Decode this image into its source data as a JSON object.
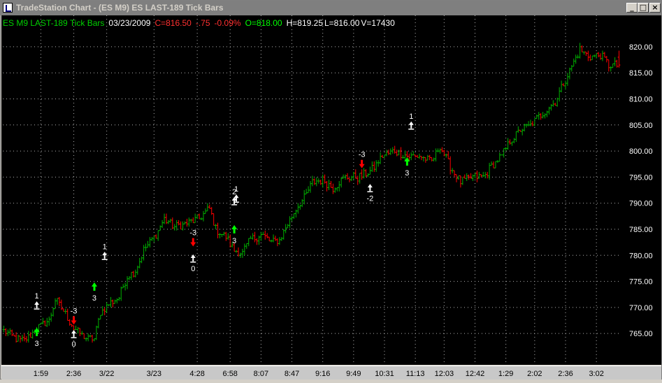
{
  "window": {
    "title": "TradeStation Chart - (ES M9) ES LAST-189 Tick Bars",
    "minimize": "_",
    "maximize": "□",
    "close": "×"
  },
  "info": {
    "symbol": "ES M9 LAST-189 Tick Bars",
    "date": "03/23/2009",
    "close": "C=816.50",
    "change": "-.75",
    "change_pct": "-0.09%",
    "open": "O=818.00",
    "high": "H=819.25",
    "low": "L=816.00",
    "volume": "V=17430"
  },
  "colors": {
    "background": "#000000",
    "up_bar": "#00b000",
    "down_bar": "#ff0000",
    "grid": "#b0b0b0",
    "info_symbol": "#00d000",
    "info_date": "#ffffff",
    "info_close": "#ff3030",
    "info_open": "#00ff00",
    "info_other": "#ffffff",
    "buy_arrow": "#00ff00",
    "sell_arrow": "#ff0000",
    "marker": "#ffffff"
  },
  "chart_data": {
    "type": "bar",
    "subtype": "ohlc-tick-bars",
    "grid": true,
    "y_axis_side": "right",
    "ylim": [
      761,
      822
    ],
    "y_ticks": [
      765,
      770,
      775,
      780,
      785,
      790,
      795,
      800,
      805,
      810,
      815,
      820
    ],
    "y_tick_labels": [
      "765.00",
      "770.00",
      "775.00",
      "780.00",
      "785.00",
      "790.00",
      "795.00",
      "800.00",
      "805.00",
      "810.00",
      "815.00",
      "820.00"
    ],
    "x_count": 300,
    "x_ticks": [
      {
        "label": "1:59",
        "i": 18
      },
      {
        "label": "2:36",
        "i": 34
      },
      {
        "label": "3/22",
        "i": 50
      },
      {
        "label": "3/23",
        "i": 73
      },
      {
        "label": "4:28",
        "i": 94
      },
      {
        "label": "6:58",
        "i": 110
      },
      {
        "label": "8:07",
        "i": 125
      },
      {
        "label": "8:47",
        "i": 140
      },
      {
        "label": "9:16",
        "i": 155
      },
      {
        "label": "9:49",
        "i": 170
      },
      {
        "label": "10:31",
        "i": 185
      },
      {
        "label": "11:13",
        "i": 200
      },
      {
        "label": "12:03",
        "i": 214
      },
      {
        "label": "12:42",
        "i": 229
      },
      {
        "label": "1:29",
        "i": 244
      },
      {
        "label": "2:02",
        "i": 258
      },
      {
        "label": "2:36",
        "i": 273
      },
      {
        "label": "3:02",
        "i": 288
      }
    ],
    "price_path": [
      [
        0,
        765.5
      ],
      [
        6,
        764
      ],
      [
        10,
        763.5
      ],
      [
        16,
        766
      ],
      [
        22,
        767.5
      ],
      [
        25,
        771.5
      ],
      [
        28,
        770
      ],
      [
        34,
        766
      ],
      [
        40,
        764
      ],
      [
        44,
        764
      ],
      [
        47,
        769
      ],
      [
        52,
        771
      ],
      [
        56,
        772
      ],
      [
        60,
        776
      ],
      [
        64,
        777
      ],
      [
        68,
        781
      ],
      [
        74,
        784
      ],
      [
        78,
        787
      ],
      [
        83,
        785.5
      ],
      [
        88,
        786
      ],
      [
        95,
        787
      ],
      [
        100,
        789
      ],
      [
        103,
        785
      ],
      [
        108,
        783.5
      ],
      [
        112,
        781
      ],
      [
        116,
        780.5
      ],
      [
        120,
        783
      ],
      [
        125,
        784
      ],
      [
        130,
        782.5
      ],
      [
        134,
        783
      ],
      [
        138,
        786
      ],
      [
        142,
        789
      ],
      [
        146,
        791
      ],
      [
        150,
        794
      ],
      [
        155,
        794.5
      ],
      [
        160,
        793
      ],
      [
        166,
        795
      ],
      [
        172,
        795
      ],
      [
        178,
        796
      ],
      [
        184,
        799
      ],
      [
        190,
        800
      ],
      [
        196,
        799
      ],
      [
        202,
        799
      ],
      [
        208,
        798
      ],
      [
        212,
        801
      ],
      [
        217,
        797
      ],
      [
        222,
        794
      ],
      [
        228,
        795
      ],
      [
        233,
        795
      ],
      [
        238,
        797.5
      ],
      [
        242,
        799
      ],
      [
        246,
        802
      ],
      [
        251,
        804
      ],
      [
        256,
        805
      ],
      [
        260,
        806.5
      ],
      [
        264,
        808
      ],
      [
        268,
        809.5
      ],
      [
        272,
        813
      ],
      [
        277,
        817
      ],
      [
        280,
        819.5
      ],
      [
        285,
        818
      ],
      [
        290,
        818.5
      ],
      [
        294,
        816.5
      ]
    ],
    "last_bar": {
      "open": 818.0,
      "high": 819.25,
      "low": 816.0,
      "close": 816.5,
      "volume": 17430
    },
    "markers": [
      {
        "i": 16,
        "price": 765.3,
        "kind": "buy",
        "label": "3"
      },
      {
        "i": 16,
        "price": 770.5,
        "kind": "exit",
        "label": "1"
      },
      {
        "i": 34,
        "price": 765.0,
        "kind": "exit",
        "label": "0"
      },
      {
        "i": 34,
        "price": 767.5,
        "kind": "sell",
        "label": "-3"
      },
      {
        "i": 44,
        "price": 774.0,
        "kind": "buy",
        "label": "3"
      },
      {
        "i": 49,
        "price": 780.0,
        "kind": "exit",
        "label": "1"
      },
      {
        "i": 92,
        "price": 779.5,
        "kind": "exit",
        "label": "0"
      },
      {
        "i": 92,
        "price": 782.5,
        "kind": "sell",
        "label": "-3"
      },
      {
        "i": 112,
        "price": 785.0,
        "kind": "buy",
        "label": "3"
      },
      {
        "i": 112,
        "price": 790.5,
        "kind": "exit",
        "label": "2"
      },
      {
        "i": 113,
        "price": 791.0,
        "kind": "exit",
        "label": "1"
      },
      {
        "i": 174,
        "price": 797.5,
        "kind": "sell",
        "label": "-3"
      },
      {
        "i": 178,
        "price": 793.0,
        "kind": "exit",
        "label": "-2"
      },
      {
        "i": 196,
        "price": 798.0,
        "kind": "buy",
        "label": "3"
      },
      {
        "i": 198,
        "price": 805.0,
        "kind": "exit",
        "label": "1"
      }
    ]
  }
}
